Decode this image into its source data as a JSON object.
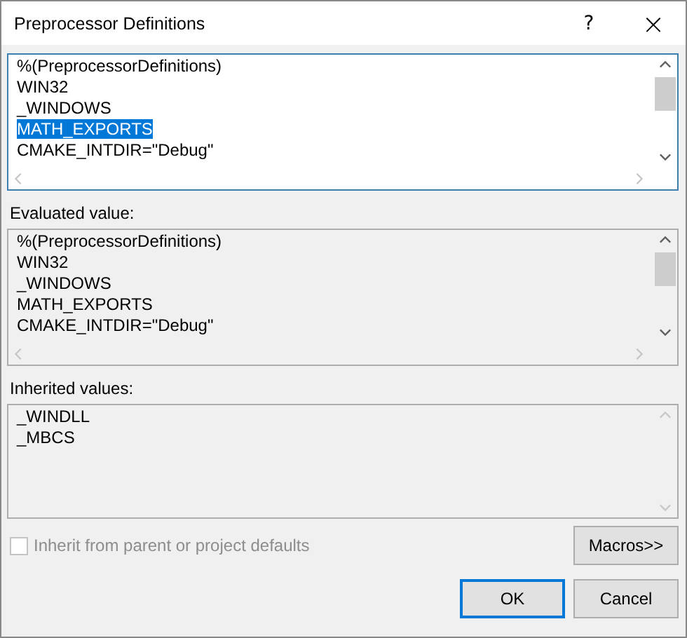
{
  "window": {
    "title": "Preprocessor Definitions",
    "help": "?",
    "close": "×"
  },
  "boxes": [
    {
      "editable": true,
      "focused": true,
      "scrollable": true,
      "lines": [
        {
          "text": "%(PreprocessorDefinitions)",
          "selected": false
        },
        {
          "text": "WIN32",
          "selected": false
        },
        {
          "text": "_WINDOWS",
          "selected": false
        },
        {
          "text": "MATH_EXPORTS",
          "selected": true
        },
        {
          "text": "CMAKE_INTDIR=\"Debug\"",
          "selected": false
        }
      ]
    },
    {
      "label": "Evaluated value:",
      "editable": false,
      "focused": false,
      "scrollable": true,
      "lines": [
        {
          "text": "%(PreprocessorDefinitions)",
          "selected": false
        },
        {
          "text": "WIN32",
          "selected": false
        },
        {
          "text": "_WINDOWS",
          "selected": false
        },
        {
          "text": "MATH_EXPORTS",
          "selected": false
        },
        {
          "text": "CMAKE_INTDIR=\"Debug\"",
          "selected": false
        }
      ]
    },
    {
      "label": "Inherited values:",
      "editable": false,
      "focused": false,
      "scrollable": false,
      "lines": [
        {
          "text": "_WINDLL",
          "selected": false
        },
        {
          "text": "_MBCS",
          "selected": false
        }
      ]
    }
  ],
  "inherit_checkbox": {
    "label": "Inherit from parent or project defaults",
    "checked": false,
    "disabled": true
  },
  "macros_button": "Macros>>",
  "buttons": [
    {
      "label": "OK",
      "default": true
    },
    {
      "label": "Cancel",
      "default": false
    }
  ]
}
